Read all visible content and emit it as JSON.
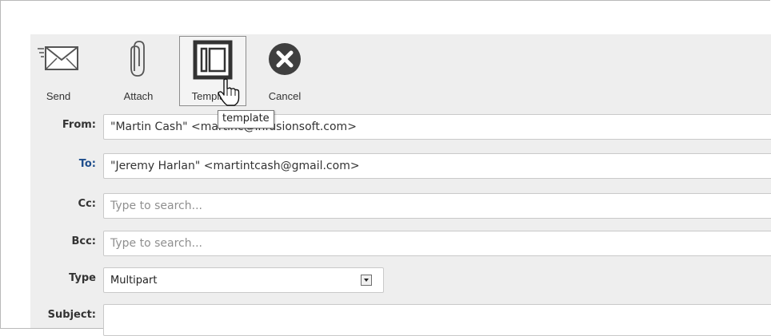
{
  "toolbar": {
    "send_label": "Send",
    "attach_label": "Attach",
    "template_label": "Template",
    "cancel_label": "Cancel",
    "tooltip": "template"
  },
  "form": {
    "from_label": "From:",
    "from_value": "\"Martin Cash\" <martinc@infusionsoft.com>",
    "to_label": "To:",
    "to_value": "\"Jeremy Harlan\" <martintcash@gmail.com>",
    "cc_label": "Cc:",
    "cc_placeholder": "Type to search...",
    "bcc_label": "Bcc:",
    "bcc_placeholder": "Type to search...",
    "type_label": "Type",
    "type_value": "Multipart",
    "subject_label": "Subject:",
    "subject_value": ""
  },
  "colors": {
    "panel_bg": "#eeeeee",
    "to_label_color": "#1f4e8c",
    "cancel_icon": "#3f3f3f"
  },
  "icons": [
    "send-envelope-icon",
    "paperclip-icon",
    "template-icon",
    "cancel-x-icon",
    "hand-cursor-icon",
    "dropdown-arrow-icon"
  ]
}
